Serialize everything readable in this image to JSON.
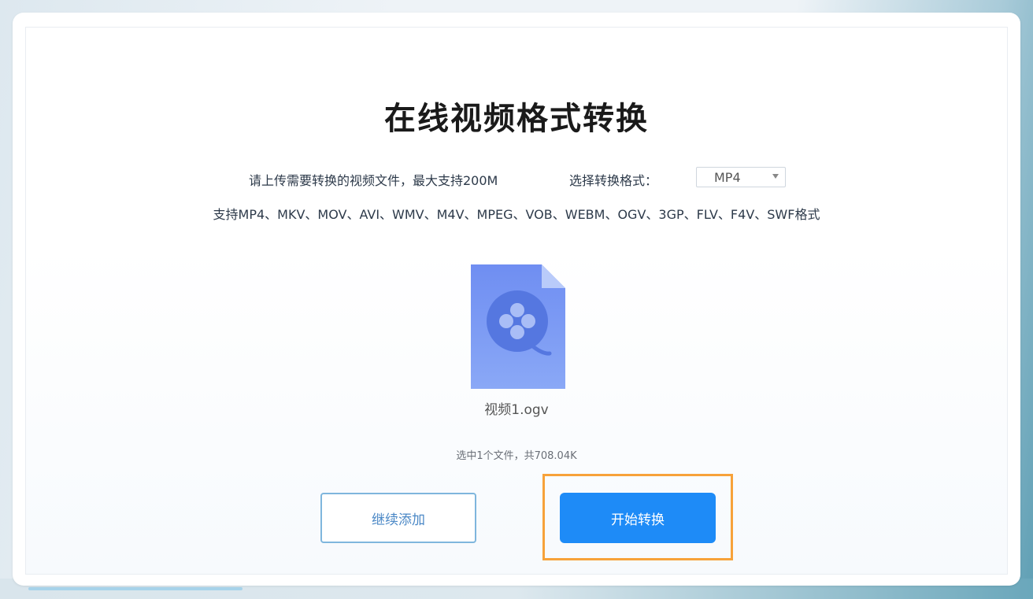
{
  "page": {
    "title": "在线视频格式转换",
    "upload_hint": "请上传需要转换的视频文件，最大支持200M",
    "format_label": "选择转换格式：",
    "format_select": {
      "selected": "MP4"
    },
    "supported_formats": "支持MP4、MKV、MOV、AVI、WMV、M4V、MPEG、VOB、WEBM、OGV、3GP、FLV、F4V、SWF格式",
    "file": {
      "name": "视频1.ogv",
      "icon": "video-file-icon"
    },
    "selection_info": "选中1个文件，共708.04K",
    "buttons": {
      "add_more": "继续添加",
      "start": "开始转换"
    }
  },
  "colors": {
    "primary": "#1e8bf7",
    "secondary_border": "#7fb6dd",
    "highlight": "#f7a23a",
    "file_icon": "#6f93f0"
  }
}
